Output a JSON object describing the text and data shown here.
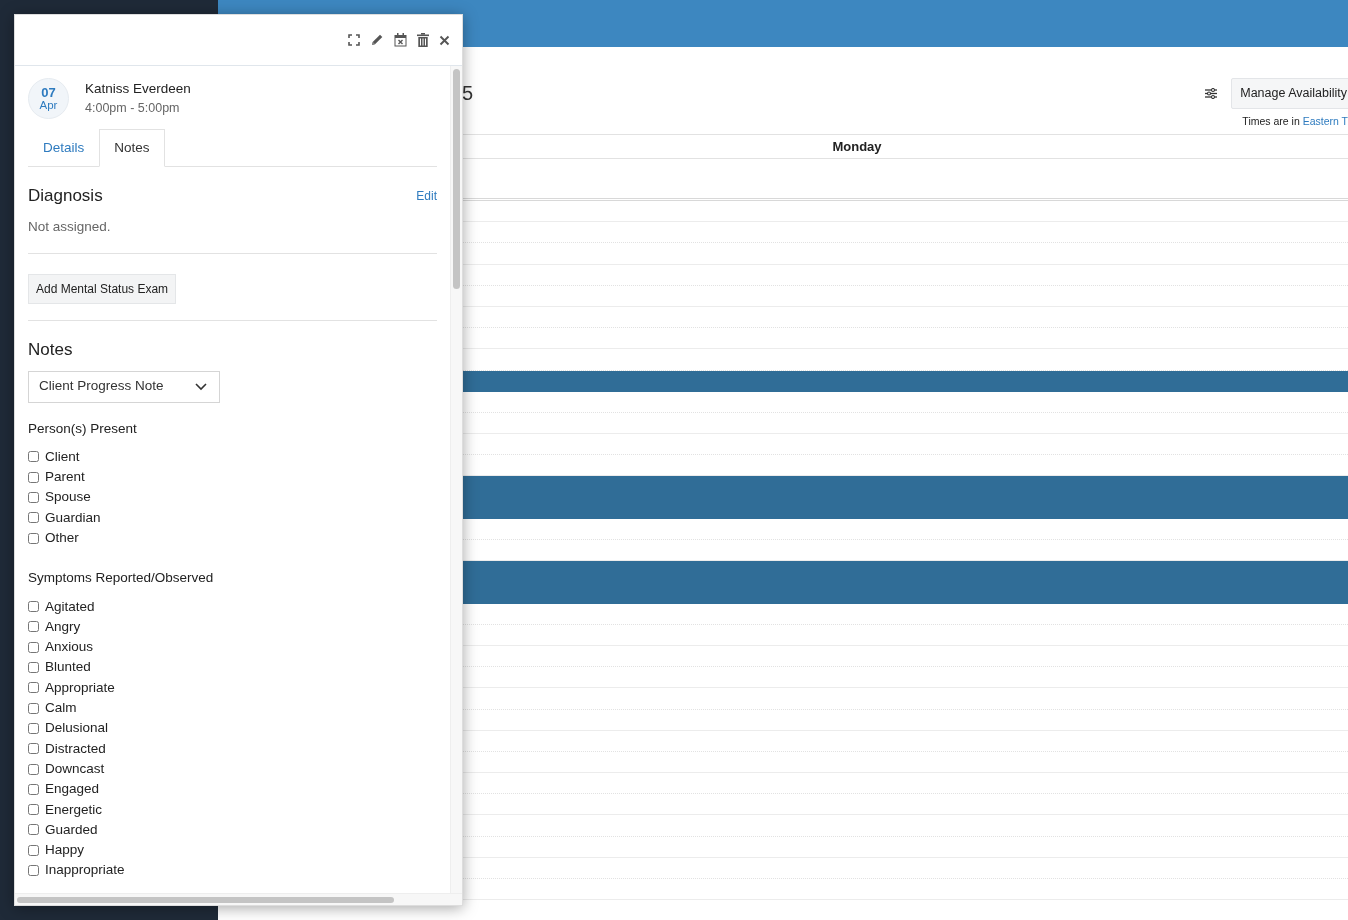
{
  "calendar": {
    "title_fragment": "5",
    "manage_button": "Manage Availability",
    "timezone_prefix": "Times are in",
    "timezone_link": "Eastern T",
    "day": "Monday",
    "slots": [
      {
        "booked": false
      },
      {
        "booked": false
      },
      {
        "booked": false
      },
      {
        "booked": false
      },
      {
        "booked": false
      },
      {
        "booked": false
      },
      {
        "booked": false
      },
      {
        "booked": false
      },
      {
        "booked": true
      },
      {
        "booked": false
      },
      {
        "booked": false
      },
      {
        "booked": false
      },
      {
        "booked": false
      },
      {
        "booked": true
      },
      {
        "booked": true
      },
      {
        "booked": false
      },
      {
        "booked": false
      },
      {
        "booked": true
      },
      {
        "booked": true
      },
      {
        "booked": false
      },
      {
        "booked": false
      },
      {
        "booked": false
      },
      {
        "booked": false
      },
      {
        "booked": false
      },
      {
        "booked": false
      },
      {
        "booked": false
      },
      {
        "booked": false
      },
      {
        "booked": false
      },
      {
        "booked": false
      },
      {
        "booked": false
      },
      {
        "booked": false
      },
      {
        "booked": false
      },
      {
        "booked": false
      }
    ]
  },
  "appointment": {
    "day": "07",
    "month": "Apr",
    "client": "Katniss Everdeen",
    "time": "4:00pm - 5:00pm"
  },
  "tabs": [
    {
      "label": "Details",
      "selected": false
    },
    {
      "label": "Notes",
      "selected": true
    }
  ],
  "diagnosis": {
    "heading": "Diagnosis",
    "edit_link": "Edit",
    "value": "Not assigned."
  },
  "mse_button": "Add Mental Status Exam",
  "notes": {
    "heading": "Notes",
    "template": "Client Progress Note"
  },
  "checkbox_groups": [
    {
      "label": "Person(s) Present",
      "options": [
        {
          "label": "Client",
          "checked": false
        },
        {
          "label": "Parent",
          "checked": false
        },
        {
          "label": "Spouse",
          "checked": false
        },
        {
          "label": "Guardian",
          "checked": false
        },
        {
          "label": "Other",
          "checked": false
        }
      ]
    },
    {
      "label": "Symptoms Reported/Observed",
      "options": [
        {
          "label": "Agitated",
          "checked": false
        },
        {
          "label": "Angry",
          "checked": false
        },
        {
          "label": "Anxious",
          "checked": false
        },
        {
          "label": "Blunted",
          "checked": false
        },
        {
          "label": "Appropriate",
          "checked": false
        },
        {
          "label": "Calm",
          "checked": false
        },
        {
          "label": "Delusional",
          "checked": false
        },
        {
          "label": "Distracted",
          "checked": false
        },
        {
          "label": "Downcast",
          "checked": false
        },
        {
          "label": "Engaged",
          "checked": false
        },
        {
          "label": "Energetic",
          "checked": false
        },
        {
          "label": "Guarded",
          "checked": false
        },
        {
          "label": "Happy",
          "checked": false
        },
        {
          "label": "Inappropriate",
          "checked": false
        }
      ]
    }
  ]
}
